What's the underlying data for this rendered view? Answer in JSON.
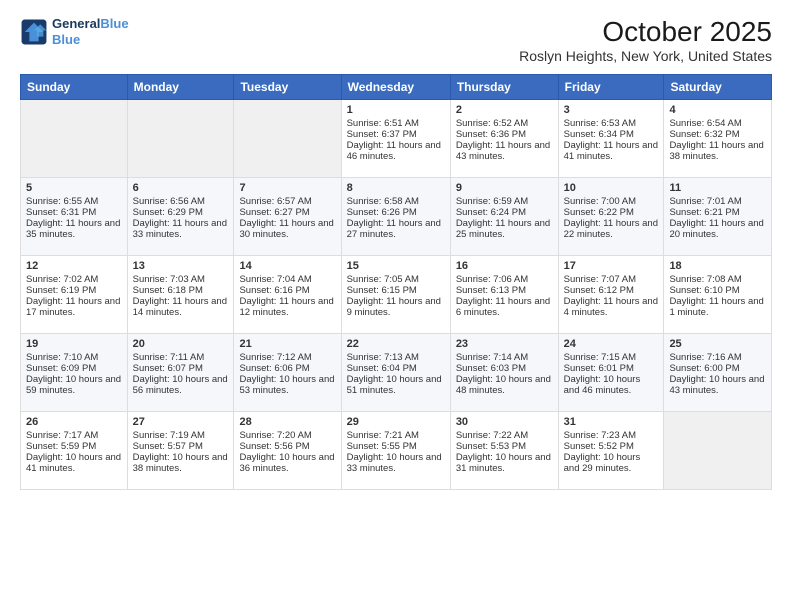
{
  "header": {
    "logo_line1": "General",
    "logo_line2": "Blue",
    "month_title": "October 2025",
    "location": "Roslyn Heights, New York, United States"
  },
  "weekdays": [
    "Sunday",
    "Monday",
    "Tuesday",
    "Wednesday",
    "Thursday",
    "Friday",
    "Saturday"
  ],
  "weeks": [
    [
      {
        "day": "",
        "data": ""
      },
      {
        "day": "",
        "data": ""
      },
      {
        "day": "",
        "data": ""
      },
      {
        "day": "1",
        "data": "Sunrise: 6:51 AM\nSunset: 6:37 PM\nDaylight: 11 hours and 46 minutes."
      },
      {
        "day": "2",
        "data": "Sunrise: 6:52 AM\nSunset: 6:36 PM\nDaylight: 11 hours and 43 minutes."
      },
      {
        "day": "3",
        "data": "Sunrise: 6:53 AM\nSunset: 6:34 PM\nDaylight: 11 hours and 41 minutes."
      },
      {
        "day": "4",
        "data": "Sunrise: 6:54 AM\nSunset: 6:32 PM\nDaylight: 11 hours and 38 minutes."
      }
    ],
    [
      {
        "day": "5",
        "data": "Sunrise: 6:55 AM\nSunset: 6:31 PM\nDaylight: 11 hours and 35 minutes."
      },
      {
        "day": "6",
        "data": "Sunrise: 6:56 AM\nSunset: 6:29 PM\nDaylight: 11 hours and 33 minutes."
      },
      {
        "day": "7",
        "data": "Sunrise: 6:57 AM\nSunset: 6:27 PM\nDaylight: 11 hours and 30 minutes."
      },
      {
        "day": "8",
        "data": "Sunrise: 6:58 AM\nSunset: 6:26 PM\nDaylight: 11 hours and 27 minutes."
      },
      {
        "day": "9",
        "data": "Sunrise: 6:59 AM\nSunset: 6:24 PM\nDaylight: 11 hours and 25 minutes."
      },
      {
        "day": "10",
        "data": "Sunrise: 7:00 AM\nSunset: 6:22 PM\nDaylight: 11 hours and 22 minutes."
      },
      {
        "day": "11",
        "data": "Sunrise: 7:01 AM\nSunset: 6:21 PM\nDaylight: 11 hours and 20 minutes."
      }
    ],
    [
      {
        "day": "12",
        "data": "Sunrise: 7:02 AM\nSunset: 6:19 PM\nDaylight: 11 hours and 17 minutes."
      },
      {
        "day": "13",
        "data": "Sunrise: 7:03 AM\nSunset: 6:18 PM\nDaylight: 11 hours and 14 minutes."
      },
      {
        "day": "14",
        "data": "Sunrise: 7:04 AM\nSunset: 6:16 PM\nDaylight: 11 hours and 12 minutes."
      },
      {
        "day": "15",
        "data": "Sunrise: 7:05 AM\nSunset: 6:15 PM\nDaylight: 11 hours and 9 minutes."
      },
      {
        "day": "16",
        "data": "Sunrise: 7:06 AM\nSunset: 6:13 PM\nDaylight: 11 hours and 6 minutes."
      },
      {
        "day": "17",
        "data": "Sunrise: 7:07 AM\nSunset: 6:12 PM\nDaylight: 11 hours and 4 minutes."
      },
      {
        "day": "18",
        "data": "Sunrise: 7:08 AM\nSunset: 6:10 PM\nDaylight: 11 hours and 1 minute."
      }
    ],
    [
      {
        "day": "19",
        "data": "Sunrise: 7:10 AM\nSunset: 6:09 PM\nDaylight: 10 hours and 59 minutes."
      },
      {
        "day": "20",
        "data": "Sunrise: 7:11 AM\nSunset: 6:07 PM\nDaylight: 10 hours and 56 minutes."
      },
      {
        "day": "21",
        "data": "Sunrise: 7:12 AM\nSunset: 6:06 PM\nDaylight: 10 hours and 53 minutes."
      },
      {
        "day": "22",
        "data": "Sunrise: 7:13 AM\nSunset: 6:04 PM\nDaylight: 10 hours and 51 minutes."
      },
      {
        "day": "23",
        "data": "Sunrise: 7:14 AM\nSunset: 6:03 PM\nDaylight: 10 hours and 48 minutes."
      },
      {
        "day": "24",
        "data": "Sunrise: 7:15 AM\nSunset: 6:01 PM\nDaylight: 10 hours and 46 minutes."
      },
      {
        "day": "25",
        "data": "Sunrise: 7:16 AM\nSunset: 6:00 PM\nDaylight: 10 hours and 43 minutes."
      }
    ],
    [
      {
        "day": "26",
        "data": "Sunrise: 7:17 AM\nSunset: 5:59 PM\nDaylight: 10 hours and 41 minutes."
      },
      {
        "day": "27",
        "data": "Sunrise: 7:19 AM\nSunset: 5:57 PM\nDaylight: 10 hours and 38 minutes."
      },
      {
        "day": "28",
        "data": "Sunrise: 7:20 AM\nSunset: 5:56 PM\nDaylight: 10 hours and 36 minutes."
      },
      {
        "day": "29",
        "data": "Sunrise: 7:21 AM\nSunset: 5:55 PM\nDaylight: 10 hours and 33 minutes."
      },
      {
        "day": "30",
        "data": "Sunrise: 7:22 AM\nSunset: 5:53 PM\nDaylight: 10 hours and 31 minutes."
      },
      {
        "day": "31",
        "data": "Sunrise: 7:23 AM\nSunset: 5:52 PM\nDaylight: 10 hours and 29 minutes."
      },
      {
        "day": "",
        "data": ""
      }
    ]
  ]
}
